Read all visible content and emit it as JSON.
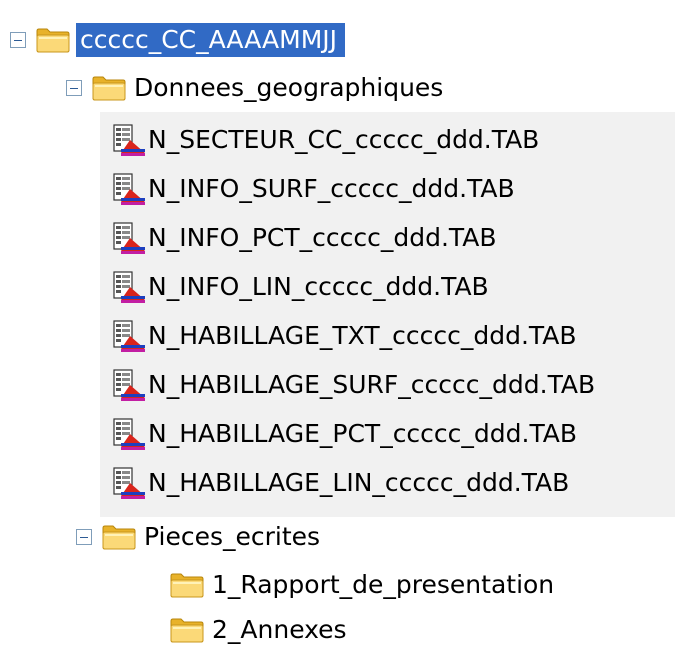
{
  "tree": {
    "root": {
      "label": "ccccc_CC_AAAAMMJJ",
      "expanded": true,
      "selected": true
    },
    "geo_folder": {
      "label": "Donnees_geographiques",
      "expanded": true,
      "files": [
        "N_SECTEUR_CC_ccccc_ddd.TAB",
        "N_INFO_SURF_ccccc_ddd.TAB",
        "N_INFO_PCT_ccccc_ddd.TAB",
        "N_INFO_LIN_ccccc_ddd.TAB",
        "N_HABILLAGE_TXT_ccccc_ddd.TAB",
        "N_HABILLAGE_SURF_ccccc_ddd.TAB",
        "N_HABILLAGE_PCT_ccccc_ddd.TAB",
        "N_HABILLAGE_LIN_ccccc_ddd.TAB"
      ]
    },
    "docs_folder": {
      "label": "Pieces_ecrites",
      "expanded": true,
      "subfolders": [
        "1_Rapport_de_presentation",
        "2_Annexes"
      ]
    }
  },
  "icons": {
    "folder": "folder-icon",
    "file": "mapinfo-table-icon",
    "collapse": "minus-expander-icon"
  },
  "colors": {
    "selection": "#316ac5",
    "folder": "#f5c84c",
    "files_background": "#f1f1f1"
  }
}
